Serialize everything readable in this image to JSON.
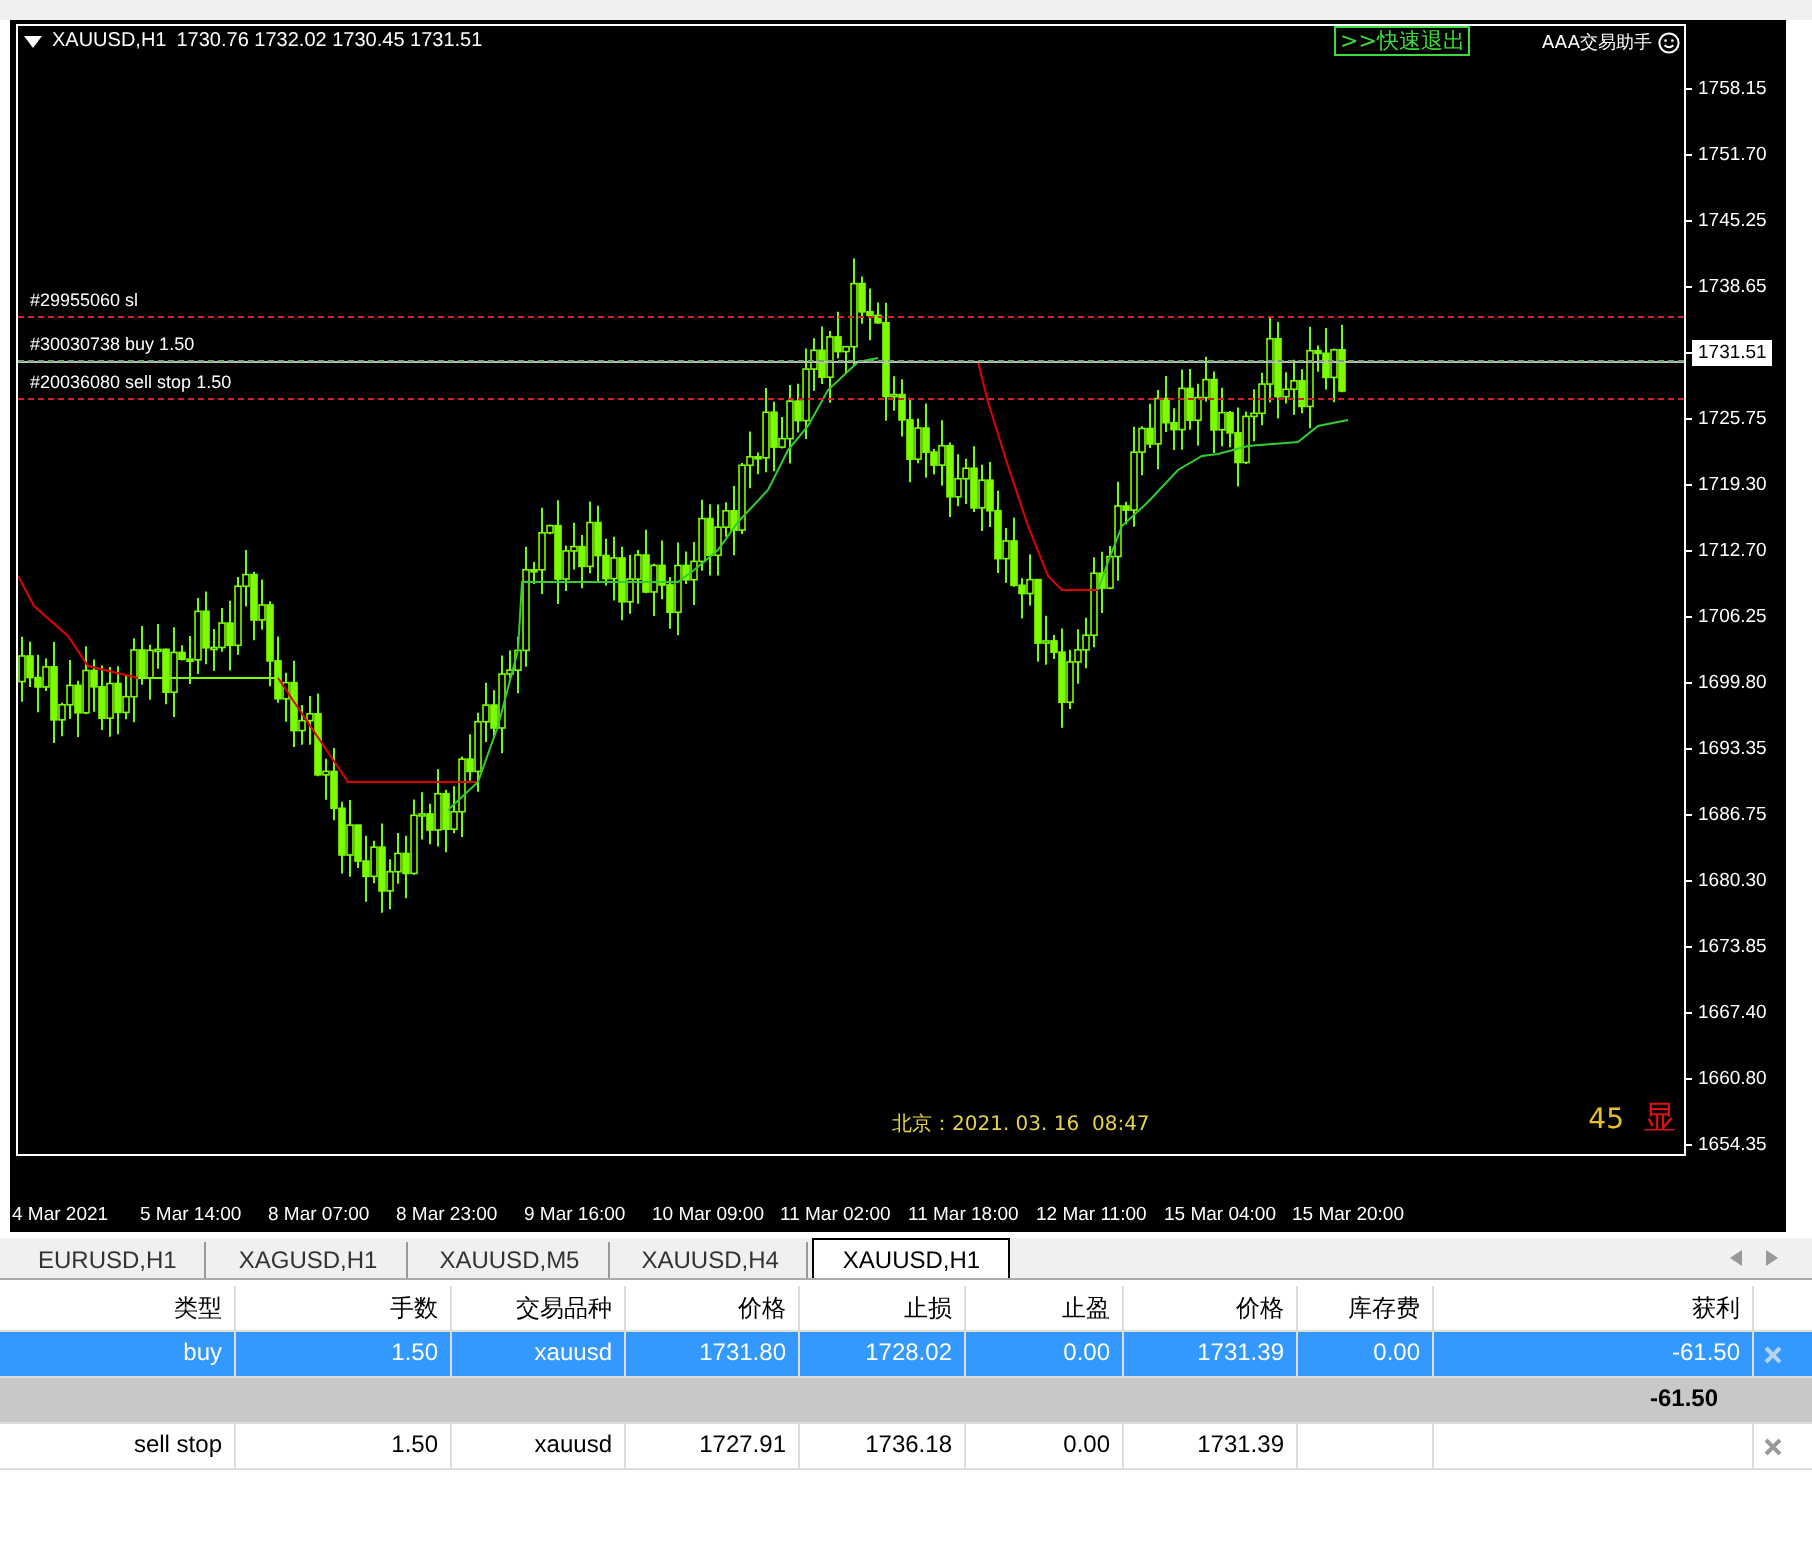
{
  "chart": {
    "symbol": "XAUUSD,H1",
    "quote": "1730.76 1732.02 1730.45 1731.51",
    "exit_button": ">>快速退出",
    "assistant_label": "AAA交易助手",
    "order_lines": [
      {
        "label": "#29955060 sl",
        "kind": "stop_loss"
      },
      {
        "label": "#30030738 buy 1.50",
        "kind": "position"
      },
      {
        "label": "#20036080 sell stop 1.50",
        "kind": "pending"
      }
    ],
    "clock": "北京：2021. 03. 16  08:47",
    "counter": "45",
    "display_toggle": "显",
    "price_axis": [
      {
        "text": "1758.15",
        "current": false
      },
      {
        "text": "1751.70",
        "current": false
      },
      {
        "text": "1745.25",
        "current": false
      },
      {
        "text": "1738.65",
        "current": false
      },
      {
        "text": "1731.51",
        "current": true
      },
      {
        "text": "1725.75",
        "current": false
      },
      {
        "text": "1719.30",
        "current": false
      },
      {
        "text": "1712.70",
        "current": false
      },
      {
        "text": "1706.25",
        "current": false
      },
      {
        "text": "1699.80",
        "current": false
      },
      {
        "text": "1693.35",
        "current": false
      },
      {
        "text": "1686.75",
        "current": false
      },
      {
        "text": "1680.30",
        "current": false
      },
      {
        "text": "1673.85",
        "current": false
      },
      {
        "text": "1667.40",
        "current": false
      },
      {
        "text": "1660.80",
        "current": false
      },
      {
        "text": "1654.35",
        "current": false
      }
    ],
    "time_axis": [
      "4 Mar 2021",
      "5 Mar 14:00",
      "8 Mar 07:00",
      "8 Mar 23:00",
      "9 Mar 16:00",
      "10 Mar 09:00",
      "11 Mar 02:00",
      "11 Mar 18:00",
      "12 Mar 11:00",
      "15 Mar 04:00",
      "15 Mar 20:00"
    ]
  },
  "tabs": [
    {
      "label": "EURUSD,H1",
      "selected": false
    },
    {
      "label": "XAGUSD,H1",
      "selected": false
    },
    {
      "label": "XAUUSD,M5",
      "selected": false
    },
    {
      "label": "XAUUSD,H4",
      "selected": false
    },
    {
      "label": "XAUUSD,H1",
      "selected": true
    }
  ],
  "table": {
    "columns": [
      "类型",
      "手数",
      "交易品种",
      "价格",
      "止损",
      "止盈",
      "价格",
      "库存费",
      "获利"
    ],
    "rows": [
      {
        "kind": "order",
        "selected": true,
        "cells": [
          "buy",
          "1.50",
          "xauusd",
          "1731.80",
          "1728.02",
          "0.00",
          "1731.39",
          "0.00",
          "-61.50"
        ]
      },
      {
        "kind": "total",
        "selected": false,
        "cells": [
          "",
          "",
          "",
          "",
          "",
          "",
          "",
          "",
          "-61.50"
        ]
      },
      {
        "kind": "order",
        "selected": false,
        "cells": [
          "sell stop",
          "1.50",
          "xauusd",
          "1727.91",
          "1736.18",
          "0.00",
          "1731.39",
          "",
          ""
        ]
      }
    ]
  }
}
